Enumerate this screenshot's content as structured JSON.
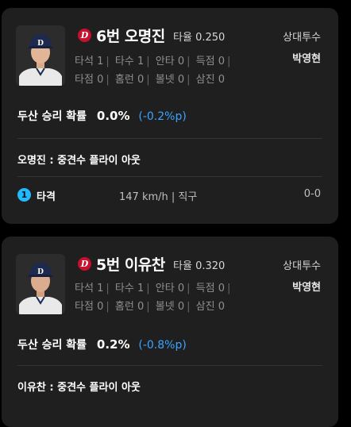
{
  "cards": [
    {
      "logo": "D",
      "player_label": "6번 오명진",
      "avg_label": "타율",
      "avg_value": "0.250",
      "opponent_label": "상대투수",
      "opponent_name": "박영현",
      "stats_row1": [
        {
          "label": "타석",
          "value": "1"
        },
        {
          "label": "타수",
          "value": "1"
        },
        {
          "label": "안타",
          "value": "0"
        },
        {
          "label": "득점",
          "value": "0"
        }
      ],
      "stats_row2": [
        {
          "label": "타점",
          "value": "0"
        },
        {
          "label": "홈런",
          "value": "0"
        },
        {
          "label": "볼넷",
          "value": "0"
        },
        {
          "label": "삼진",
          "value": "0"
        }
      ],
      "win_prob_label": "두산 승리 확률",
      "win_prob_value": "0.0%",
      "win_prob_delta": "(-0.2%p)",
      "result": "오명진 : 중견수 플라이 아웃",
      "pitch": {
        "number": "1",
        "label": "타격",
        "detail": "147 km/h | 직구",
        "count": "0-0"
      }
    },
    {
      "logo": "D",
      "player_label": "5번 이유찬",
      "avg_label": "타율",
      "avg_value": "0.320",
      "opponent_label": "상대투수",
      "opponent_name": "박영현",
      "stats_row1": [
        {
          "label": "타석",
          "value": "1"
        },
        {
          "label": "타수",
          "value": "1"
        },
        {
          "label": "안타",
          "value": "0"
        },
        {
          "label": "득점",
          "value": "0"
        }
      ],
      "stats_row2": [
        {
          "label": "타점",
          "value": "0"
        },
        {
          "label": "홈런",
          "value": "0"
        },
        {
          "label": "볼넷",
          "value": "0"
        },
        {
          "label": "삼진",
          "value": "0"
        }
      ],
      "win_prob_label": "두산 승리 확률",
      "win_prob_value": "0.2%",
      "win_prob_delta": "(-0.8%p)",
      "result": "이유찬 : 중견수 플라이 아웃"
    }
  ],
  "colors": {
    "background": "#000000",
    "card": "#1f1f1f",
    "delta_blue": "#3ba3ff",
    "pitch_badge": "#22b9ff",
    "team_red": "#c8102e"
  }
}
